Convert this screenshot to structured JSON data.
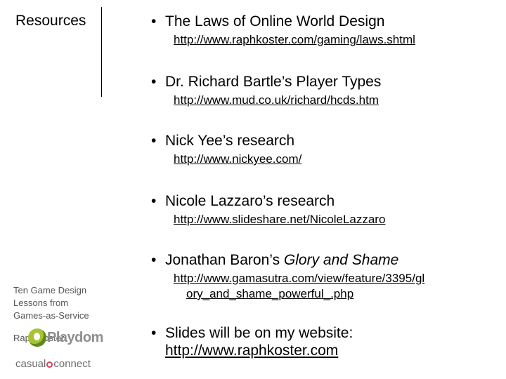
{
  "sidebar": {
    "title": "Resources",
    "caption": "Ten Game Design Lessons from Games-as-Service",
    "author": "Raph Koster",
    "playdom_logo": "Playdom",
    "casual_logo_word1": "casual",
    "casual_logo_word2": "connect"
  },
  "resources": [
    {
      "label": "The Laws of Online World Design",
      "url": "http://www.raphkoster.com/gaming/laws.shtml"
    },
    {
      "label": "Dr. Richard Bartle’s Player Types",
      "url": "http://www.mud.co.uk/richard/hcds.htm"
    },
    {
      "label": "Nick Yee’s research",
      "url": "http://www.nickyee.com/"
    },
    {
      "label": "Nicole Lazzaro’s research",
      "url": "http://www.slideshare.net/NicoleLazzaro"
    },
    {
      "label_prefix": "Jonathan Baron’s ",
      "label_italic": "Glory and Shame",
      "url_line1": "http://www.gamasutra.com/view/feature/3395/gl",
      "url_line2": "ory_and_shame_powerful_.php"
    },
    {
      "label": "Slides will be on my website:",
      "url": "http://www.raphkoster.com"
    }
  ],
  "colors": {
    "text": "#000000",
    "caption": "#555555",
    "playdom_green": "#a8c232",
    "casual_red": "#e23d58"
  }
}
